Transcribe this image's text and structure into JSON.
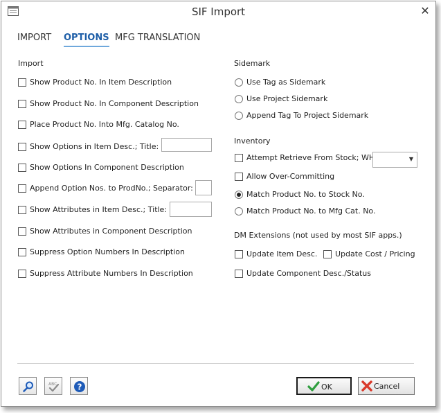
{
  "window": {
    "title": "SIF Import"
  },
  "tabs": [
    {
      "label": "IMPORT"
    },
    {
      "label": "OPTIONS"
    },
    {
      "label": "MFG TRANSLATION"
    }
  ],
  "import": {
    "heading": "Import",
    "items": [
      {
        "label": "Show Product No. In Item Description",
        "checked": false
      },
      {
        "label": "Show Product No. In Component Description",
        "checked": false
      },
      {
        "label": "Place Product No. Into Mfg. Catalog No.",
        "checked": false
      },
      {
        "label": "Show Options in Item Desc.; Title:",
        "checked": false,
        "field_value": ""
      },
      {
        "label": "Show Options In Component Description",
        "checked": false
      },
      {
        "label": "Append Option Nos. to ProdNo.; Separator:",
        "checked": false,
        "field_value": ""
      },
      {
        "label": "Show Attributes in Item Desc.; Title:",
        "checked": false,
        "field_value": ""
      },
      {
        "label": "Show Attributes in Component Description",
        "checked": false
      },
      {
        "label": "Suppress Option Numbers In Description",
        "checked": false
      },
      {
        "label": "Suppress Attribute Numbers In Description",
        "checked": false
      }
    ]
  },
  "sidemark": {
    "heading": "Sidemark",
    "options": [
      {
        "label": "Use Tag as Sidemark",
        "selected": false
      },
      {
        "label": "Use Project Sidemark",
        "selected": false
      },
      {
        "label": "Append Tag To Project Sidemark",
        "selected": false
      }
    ]
  },
  "inventory": {
    "heading": "Inventory",
    "attempt_retrieve": {
      "label": "Attempt Retrieve From Stock; WH:",
      "checked": false,
      "warehouse_value": ""
    },
    "allow_over": {
      "label": "Allow Over-Committing",
      "checked": false
    },
    "match_options": [
      {
        "label": "Match Product No. to Stock No.",
        "selected": true
      },
      {
        "label": "Match Product No. to Mfg Cat. No.",
        "selected": false
      }
    ]
  },
  "dm": {
    "heading": "DM Extensions (not used by most SIF apps.)",
    "update_item_desc": {
      "label": "Update Item Desc.",
      "checked": false
    },
    "update_cost": {
      "label": "Update Cost / Pricing",
      "checked": false
    },
    "update_component": {
      "label": "Update Component Desc./Status",
      "checked": false
    }
  },
  "buttons": {
    "ok": "OK",
    "cancel": "Cancel"
  },
  "colors": {
    "accent": "#1f5fa8",
    "ok_check": "#2e9e3e",
    "cancel_x": "#d93a2b",
    "help": "#1e5bb8"
  }
}
